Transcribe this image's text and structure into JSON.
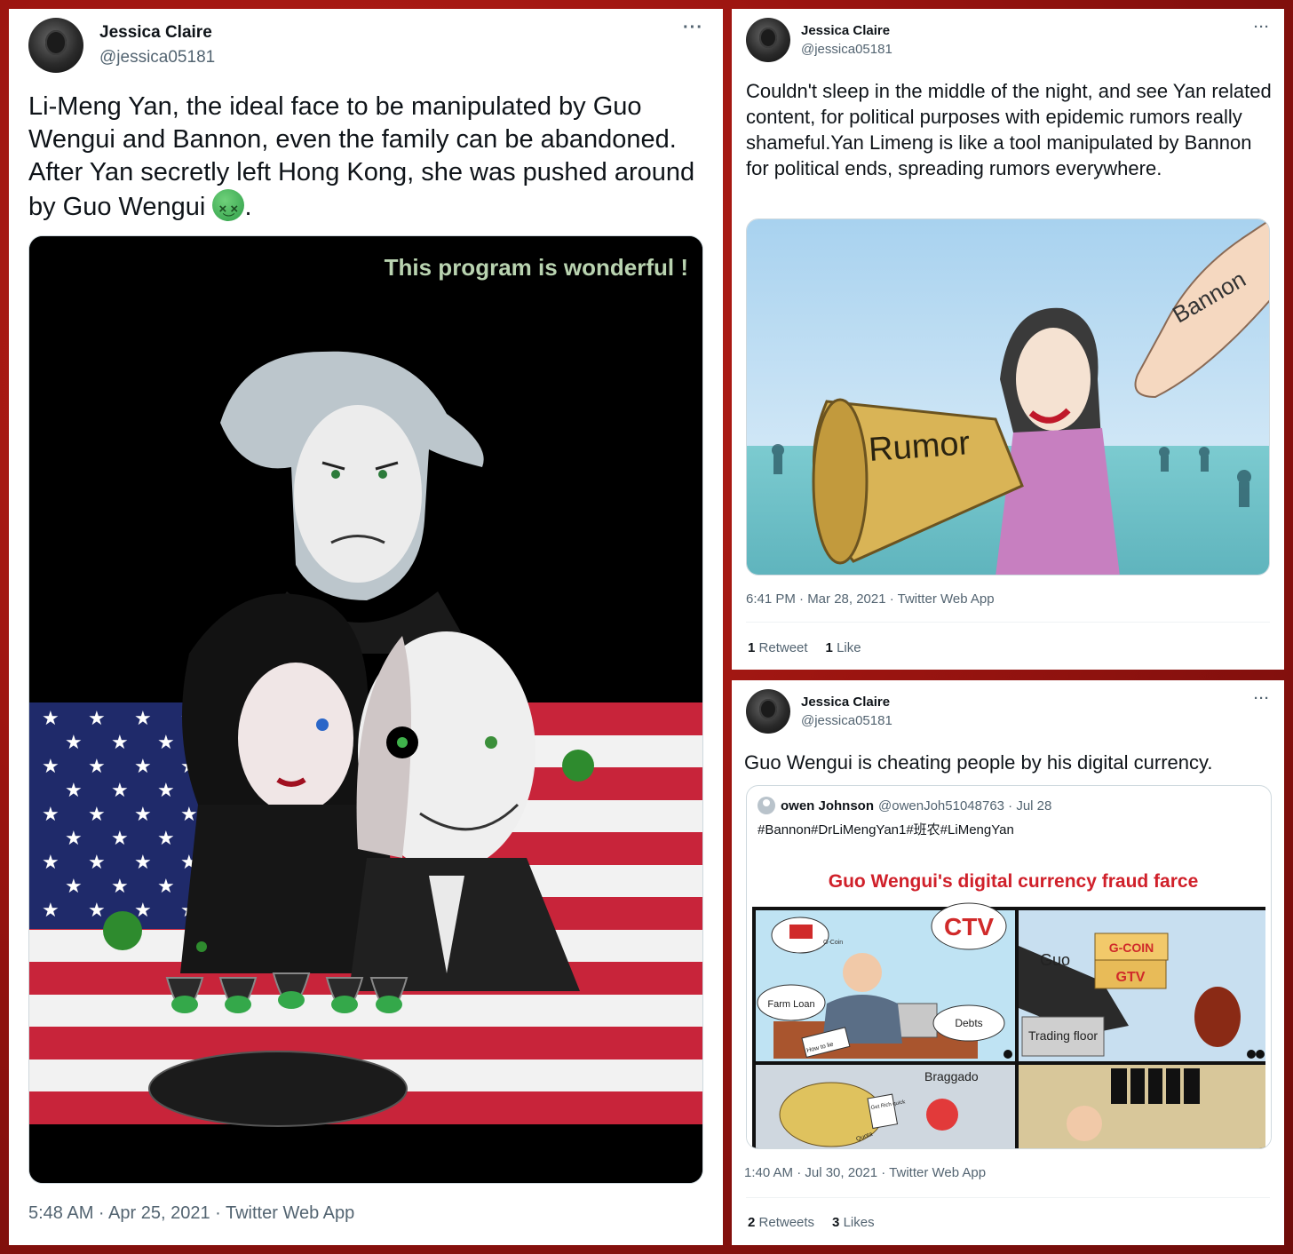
{
  "tweets": [
    {
      "author": {
        "name": "Jessica Claire",
        "handle": "@jessica05181"
      },
      "more": "···",
      "text": "Li-Meng Yan, the ideal face to be manipulated by Guo Wengui and Bannon, even the family can be abandoned. After Yan secretly left Hong Kong, she was pushed around by Guo Wengui",
      "text_suffix": ".",
      "emoji": "nauseated-face-icon",
      "image": {
        "caption": "This program is wonderful !"
      },
      "meta": "5:48 AM · Apr 25, 2021 · Twitter Web App"
    },
    {
      "author": {
        "name": "Jessica Claire",
        "handle": "@jessica05181"
      },
      "more": "···",
      "text": "Couldn't sleep in the middle of the night, and see Yan related content, for political purposes with epidemic rumors really shameful.Yan Limeng is like a tool manipulated by Bannon for political ends, spreading rumors everywhere.",
      "image": {
        "megaphone_label": "Rumor",
        "hand_label": "Bannon"
      },
      "meta": "6:41 PM · Mar 28, 2021 · Twitter Web App",
      "stats": {
        "retweets_count": "1",
        "retweets_label": "Retweet",
        "likes_count": "1",
        "likes_label": "Like"
      }
    },
    {
      "author": {
        "name": "Jessica Claire",
        "handle": "@jessica05181"
      },
      "more": "···",
      "text": "Guo Wengui is cheating people by his digital currency.",
      "quote": {
        "name": "owen Johnson",
        "handle": "@owenJoh51048763 · Jul 28",
        "text": "#Bannon#DrLiMengYan1#班农#LiMengYan",
        "comic": {
          "title": "Guo Wengui's digital currency fraud farce",
          "labels": {
            "gcoin_small": "G-Coin",
            "ctv": "CTV",
            "farm_loan": "Farm Loan",
            "debts": "Debts",
            "how_to_lie": "How to lie",
            "guo": "Guo",
            "gcoin_box": "G-COIN",
            "gtv_box": "GTV",
            "trading_floor": "Trading floor",
            "braggado": "Braggado",
            "get_rich": "Get Rich quick",
            "quota": "Quota"
          }
        }
      },
      "meta": "1:40 AM · Jul 30, 2021 · Twitter Web App",
      "stats": {
        "retweets_count": "2",
        "retweets_label": "Retweets",
        "likes_count": "3",
        "likes_label": "Likes"
      }
    }
  ],
  "colors": {
    "background": "#9a1410",
    "text": "#0f1419",
    "secondary": "#536471",
    "comic_title": "#d0202a",
    "caption": "#b9d3b0"
  }
}
